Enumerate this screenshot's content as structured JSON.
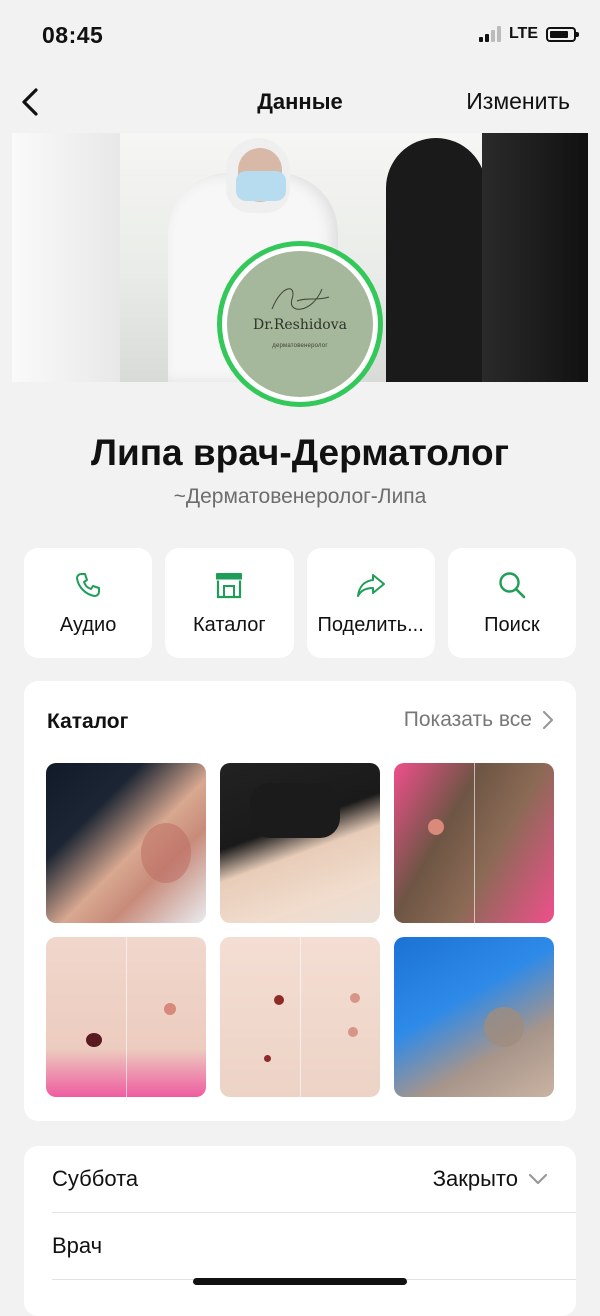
{
  "status_bar": {
    "time": "08:45",
    "network": "LTE",
    "battery_level": 0.8
  },
  "nav": {
    "back_icon": "chevron-left-icon",
    "title": "Данные",
    "edit_label": "Изменить"
  },
  "avatar": {
    "name": "Dr.Reshidova",
    "subtitle": "дерматовенеролог"
  },
  "profile": {
    "name": "Липа врач-Дерматолог",
    "subtitle": "~Дерматовенеролог-Липа"
  },
  "actions": [
    {
      "label": "Аудио",
      "icon": "phone-icon"
    },
    {
      "label": "Каталог",
      "icon": "store-icon"
    },
    {
      "label": "Поделить...",
      "icon": "share-arrow-icon"
    },
    {
      "label": "Поиск",
      "icon": "search-icon"
    }
  ],
  "catalog": {
    "title": "Каталог",
    "show_all": "Показать все",
    "show_all_icon": "chevron-right-icon",
    "items": [
      "photo-1",
      "photo-2",
      "photo-3",
      "photo-4",
      "photo-5",
      "photo-6"
    ]
  },
  "hours": {
    "day": "Суббота",
    "status": "Закрыто",
    "status_icon": "chevron-down-icon",
    "next_row": "Врач"
  },
  "colors": {
    "accent": "#1f9e57",
    "avatar_ring": "#34c759",
    "background": "#f2f2f2"
  }
}
